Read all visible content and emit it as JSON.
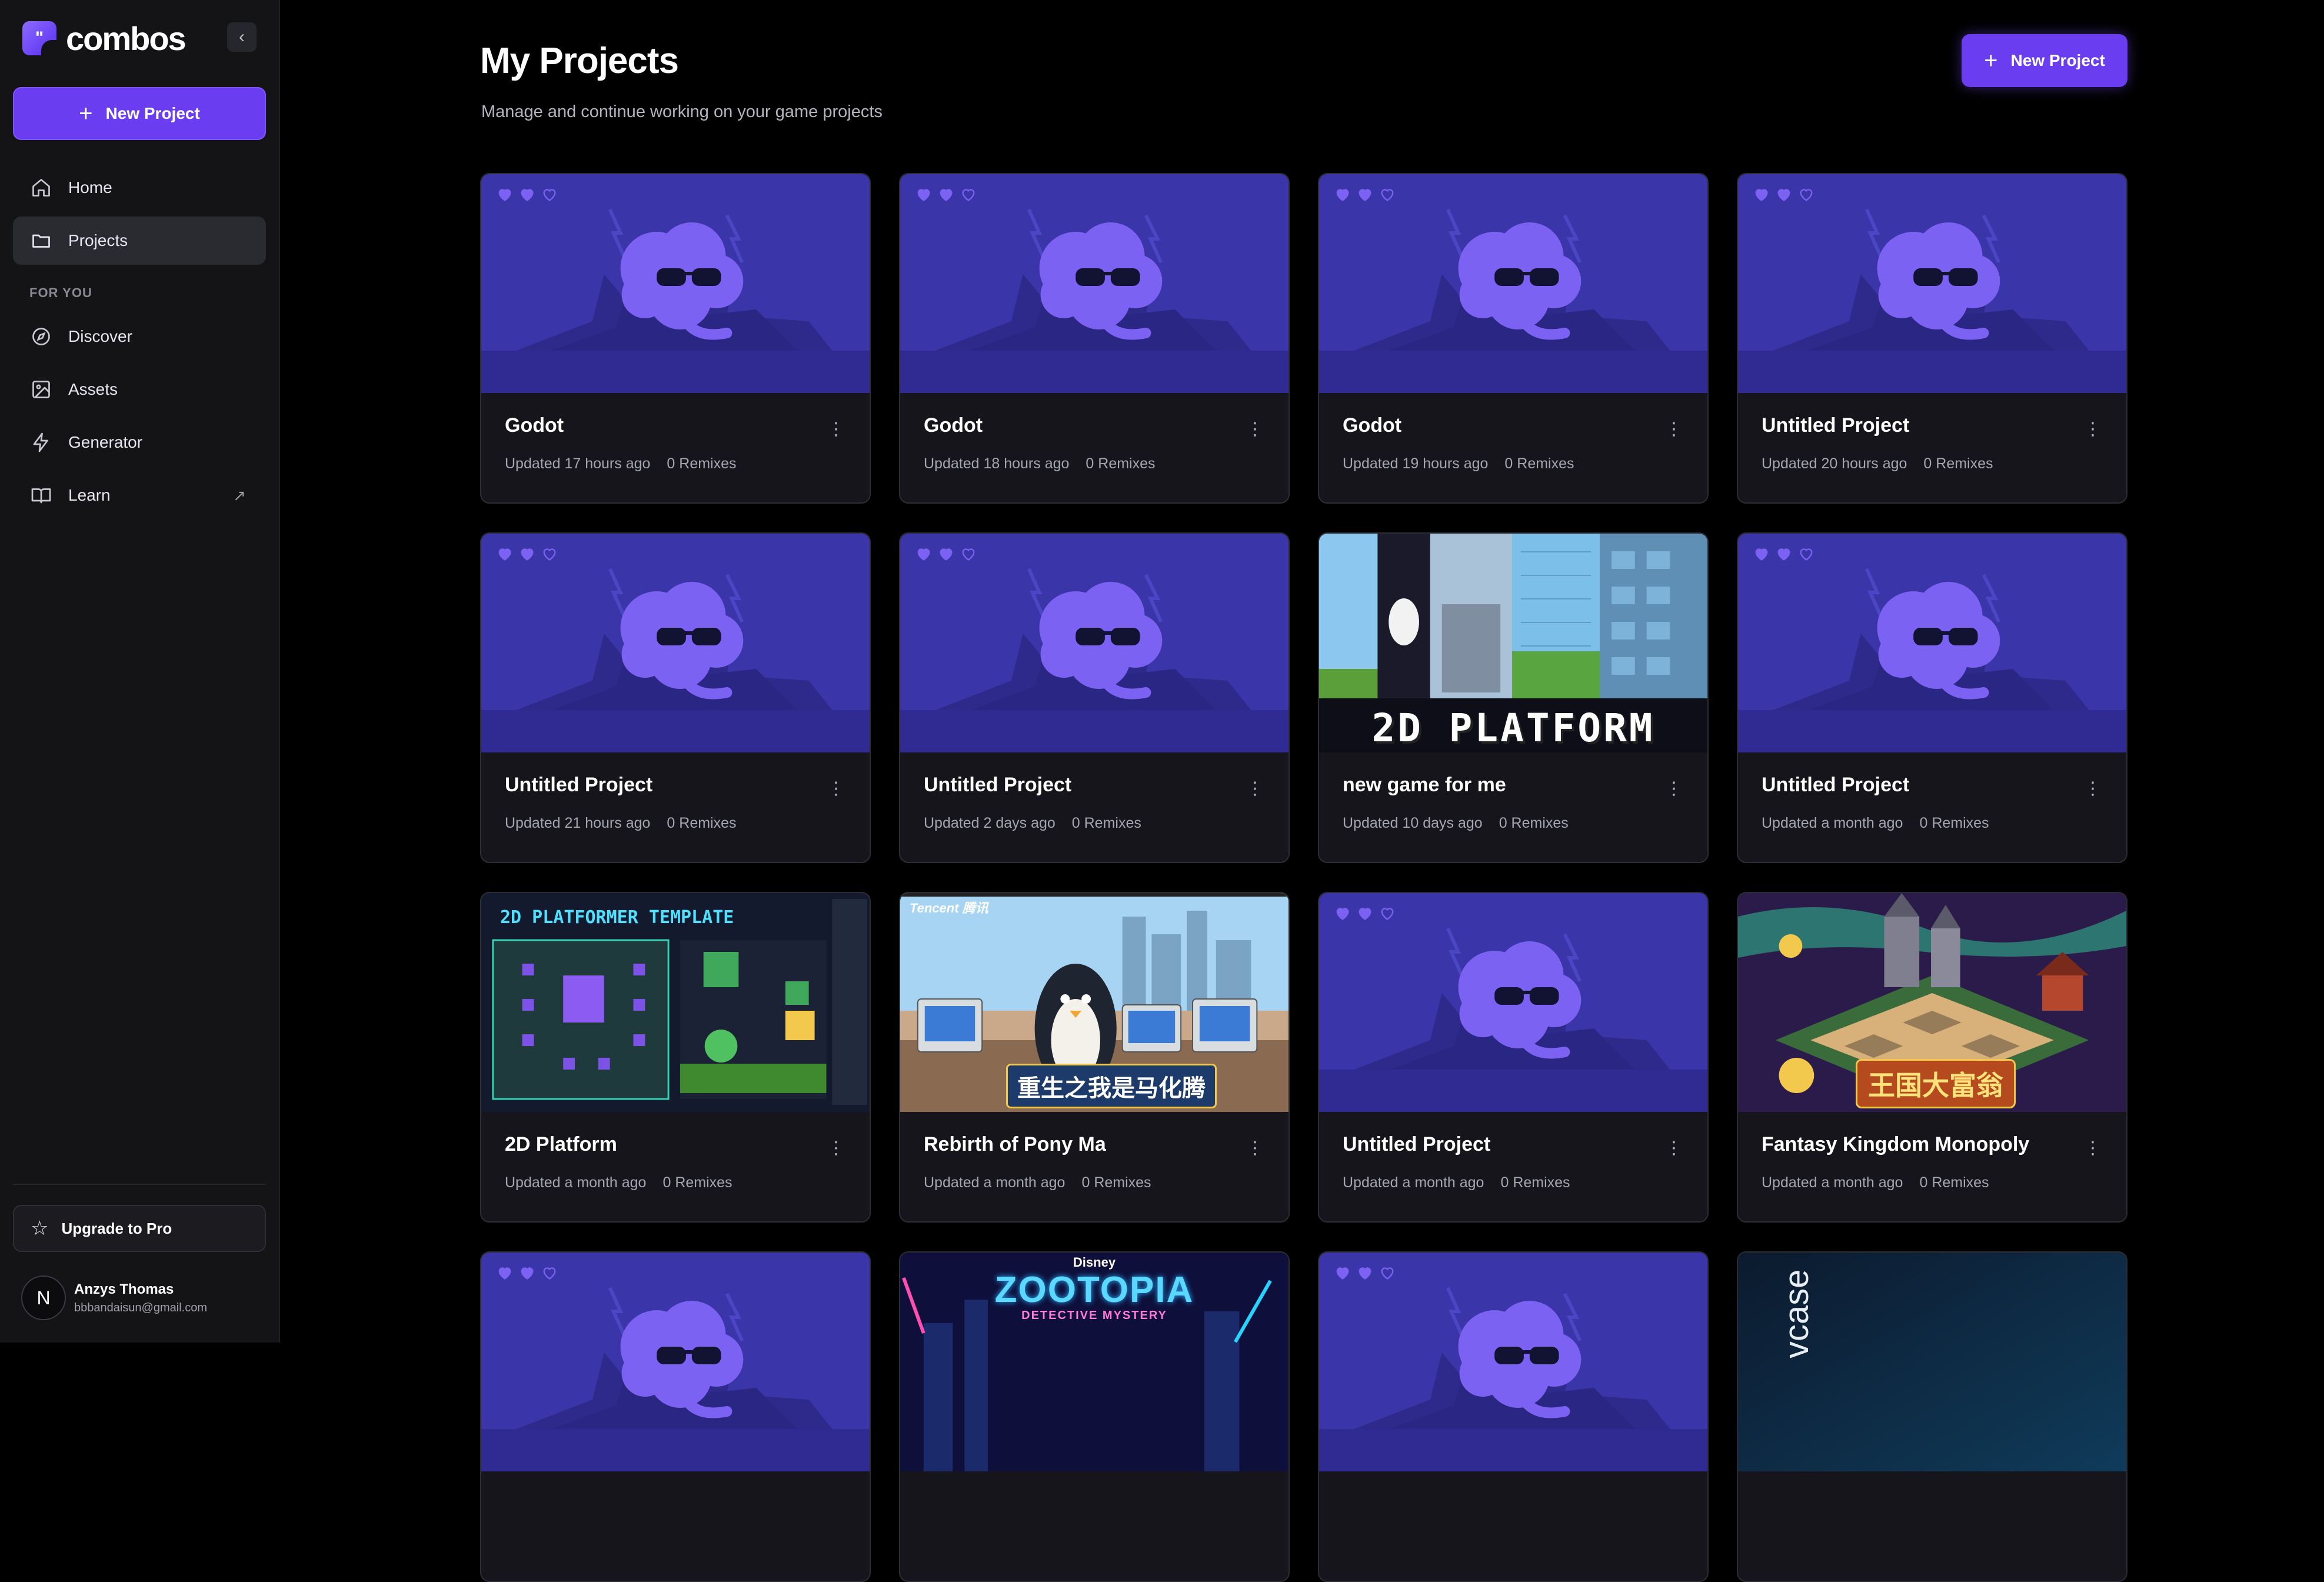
{
  "app": {
    "brand": "combos",
    "logo_glyph": "\"",
    "accent_color": "#6a3ef0",
    "collapse_icon": "chevron-left-icon"
  },
  "sidebar": {
    "new_project_label": "New Project",
    "nav": [
      {
        "label": "Home",
        "icon": "home-icon"
      },
      {
        "label": "Projects",
        "icon": "folder-icon",
        "active": true
      }
    ],
    "section_label": "FOR YOU",
    "for_you": [
      {
        "label": "Discover",
        "icon": "compass-icon"
      },
      {
        "label": "Assets",
        "icon": "image-icon"
      },
      {
        "label": "Generator",
        "icon": "lightning-icon"
      },
      {
        "label": "Learn",
        "icon": "book-icon",
        "external": true
      }
    ],
    "upgrade_label": "Upgrade to Pro",
    "user": {
      "initial": "N",
      "name": "Anzys Thomas",
      "email": "bbbandaisun@gmail.com"
    }
  },
  "header": {
    "title": "My Projects",
    "subtitle": "Manage and continue working on your game projects",
    "new_project_label": "New Project"
  },
  "projects": [
    {
      "title": "Godot",
      "updated": "Updated 17 hours ago",
      "remixes": "0 Remixes",
      "thumbnail": "mascot-placeholder"
    },
    {
      "title": "Godot",
      "updated": "Updated 18 hours ago",
      "remixes": "0 Remixes",
      "thumbnail": "mascot-placeholder"
    },
    {
      "title": "Godot",
      "updated": "Updated 19 hours ago",
      "remixes": "0 Remixes",
      "thumbnail": "mascot-placeholder"
    },
    {
      "title": "Untitled Project",
      "updated": "Updated 20 hours ago",
      "remixes": "0 Remixes",
      "thumbnail": "mascot-placeholder"
    },
    {
      "title": "Untitled Project",
      "updated": "Updated 21 hours ago",
      "remixes": "0 Remixes",
      "thumbnail": "mascot-placeholder"
    },
    {
      "title": "Untitled Project",
      "updated": "Updated 2 days ago",
      "remixes": "0 Remixes",
      "thumbnail": "mascot-placeholder"
    },
    {
      "title": "new game for me",
      "updated": "Updated 10 days ago",
      "remixes": "0 Remixes",
      "thumbnail": "2d-platform-art",
      "thumb_text": "2D PLATFORM"
    },
    {
      "title": "Untitled Project",
      "updated": "Updated a month ago",
      "remixes": "0 Remixes",
      "thumbnail": "mascot-placeholder"
    },
    {
      "title": "2D Platform",
      "updated": "Updated a month ago",
      "remixes": "0 Remixes",
      "thumbnail": "platformer-template-art",
      "thumb_text": "2D PLATFORMER TEMPLATE"
    },
    {
      "title": "Rebirth of Pony Ma",
      "updated": "Updated a month ago",
      "remixes": "0 Remixes",
      "thumbnail": "office-penguin-art",
      "thumb_text": "重生之我是马化腾",
      "thumb_badge": "Tencent 腾讯"
    },
    {
      "title": "Untitled Project",
      "updated": "Updated a month ago",
      "remixes": "0 Remixes",
      "thumbnail": "mascot-placeholder"
    },
    {
      "title": "Fantasy Kingdom Monopoly",
      "updated": "Updated a month ago",
      "remixes": "0 Remixes",
      "thumbnail": "kingdom-board-art",
      "thumb_text": "王国大富翁"
    },
    {
      "title": "",
      "updated": "",
      "remixes": "",
      "thumbnail": "mascot-placeholder"
    },
    {
      "title": "",
      "updated": "",
      "remixes": "",
      "thumbnail": "zootopia-art",
      "thumb_text": "ZOOTOPIA",
      "thumb_sub": "DETECTIVE MYSTERY",
      "thumb_badge": "Disney"
    },
    {
      "title": "",
      "updated": "",
      "remixes": "",
      "thumbnail": "mascot-placeholder"
    },
    {
      "title": "",
      "updated": "",
      "remixes": "",
      "thumbnail": "showcase-art",
      "thumb_text": "vcase"
    }
  ]
}
